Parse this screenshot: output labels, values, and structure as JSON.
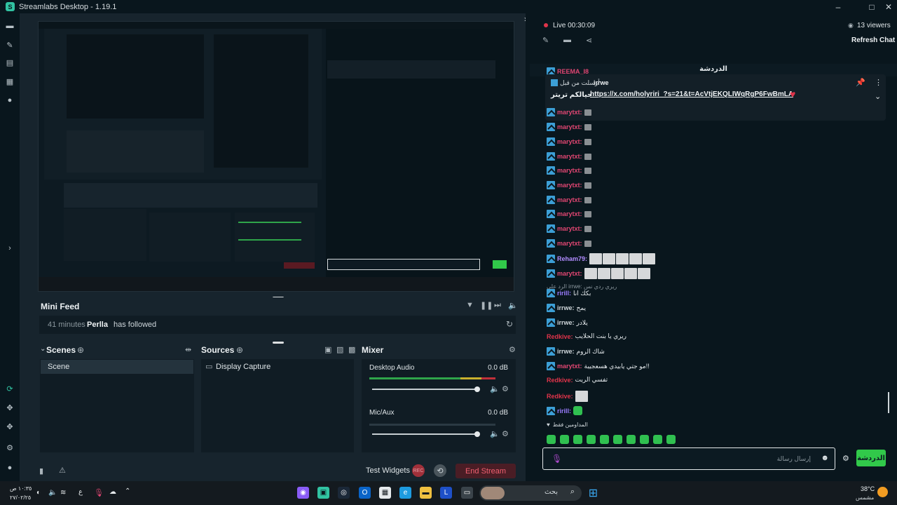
{
  "window": {
    "title": "Streamlabs Desktop - 1.19.1",
    "logo_letter": "S"
  },
  "minifeed": {
    "title": "Mini Feed",
    "event": {
      "time": "41 minutes",
      "user": "Perlla",
      "action": "has followed"
    }
  },
  "scenes": {
    "title": "Scenes",
    "items": [
      "Scene"
    ]
  },
  "sources": {
    "title": "Sources",
    "items": [
      "Display Capture"
    ]
  },
  "mixer": {
    "title": "Mixer",
    "channels": [
      {
        "name": "Desktop Audio",
        "level": "0.0 dB",
        "volume": 0.97
      },
      {
        "name": "Mic/Aux",
        "level": "0.0 dB",
        "volume": 0.97
      }
    ]
  },
  "footer": {
    "test_widgets": "Test Widgets",
    "rec": "REC",
    "end_stream": "End Stream"
  },
  "chat": {
    "live": "Live 00:30:09",
    "viewers": "13 viewers",
    "refresh": "Refresh Chat",
    "title": "الدردشة",
    "pinned": {
      "header": "أرسلت من قبل",
      "user": "irrwe",
      "prefix": "حيالكم تريتر",
      "link": "https://x.com/holyriri_?s=21&t=AcVtjEKQLIWqRgP6FwBmLA"
    },
    "top_cut_user": "REEMA_I8",
    "reply_note": "الرد على irrwe: ريري ردي نس",
    "subs_only": "المداومين فقط",
    "messages": [
      {
        "user": "marytxt",
        "text": "",
        "color": "#e04672",
        "kind": "emote1"
      },
      {
        "user": "marytxt",
        "text": "",
        "color": "#e04672",
        "kind": "emote1"
      },
      {
        "user": "marytxt",
        "text": "",
        "color": "#e04672",
        "kind": "emote1"
      },
      {
        "user": "marytxt",
        "text": "",
        "color": "#e04672",
        "kind": "emote1"
      },
      {
        "user": "marytxt",
        "text": "",
        "color": "#e04672",
        "kind": "emote1"
      },
      {
        "user": "marytxt",
        "text": "",
        "color": "#e04672",
        "kind": "emote1"
      },
      {
        "user": "marytxt",
        "text": "",
        "color": "#e04672",
        "kind": "emote1"
      },
      {
        "user": "marytxt",
        "text": "",
        "color": "#e04672",
        "kind": "emote1"
      },
      {
        "user": "marytxt",
        "text": "",
        "color": "#e04672",
        "kind": "emote1"
      },
      {
        "user": "marytxt",
        "text": "",
        "color": "#e04672",
        "kind": "emote1"
      },
      {
        "user": "Reham79",
        "text": "",
        "color": "#b18cff",
        "kind": "emote5"
      },
      {
        "user": "marytxt",
        "text": "",
        "color": "#e04672",
        "kind": "emote5"
      },
      {
        "user": "ririll",
        "text": "بكك انا",
        "color": "#9a7cff",
        "kind": "text"
      },
      {
        "user": "irrwe",
        "text": "يمح",
        "color": "#cfd6da",
        "kind": "text"
      },
      {
        "user": "irrwe",
        "text": "يلادر",
        "color": "#cfd6da",
        "kind": "text"
      },
      {
        "user": "Redkive",
        "text": "ريري يا بنت الحلايب",
        "color": "#e0344a",
        "kind": "text"
      },
      {
        "user": "irrwe",
        "text": "شاك الروم",
        "color": "#cfd6da",
        "kind": "text"
      },
      {
        "user": "marytxt",
        "text": "مو جتي يابيدي هسعجيبة!!",
        "color": "#e04672",
        "kind": "text"
      },
      {
        "user": "Redkive",
        "text": "تفسي الريت",
        "color": "#e0344a",
        "kind": "text"
      },
      {
        "user": "Redkive",
        "text": "",
        "color": "#e0344a",
        "kind": "emote2"
      },
      {
        "user": "ririll",
        "text": "",
        "color": "#9a7cff",
        "kind": "emote3"
      }
    ],
    "input_placeholder": "إرسال رسالة",
    "send": "الدردشة"
  },
  "taskbar": {
    "time": "١٠:٣٥ ص",
    "date": "٢٧/٠٢/٢٥",
    "lang": "ع",
    "search": "بحث",
    "weather_temp": "38°C",
    "weather_desc": "مشمس"
  },
  "colors": {
    "accent": "#31c3a2",
    "end_stream": "#e0344a",
    "chat_send": "#31c94a"
  }
}
